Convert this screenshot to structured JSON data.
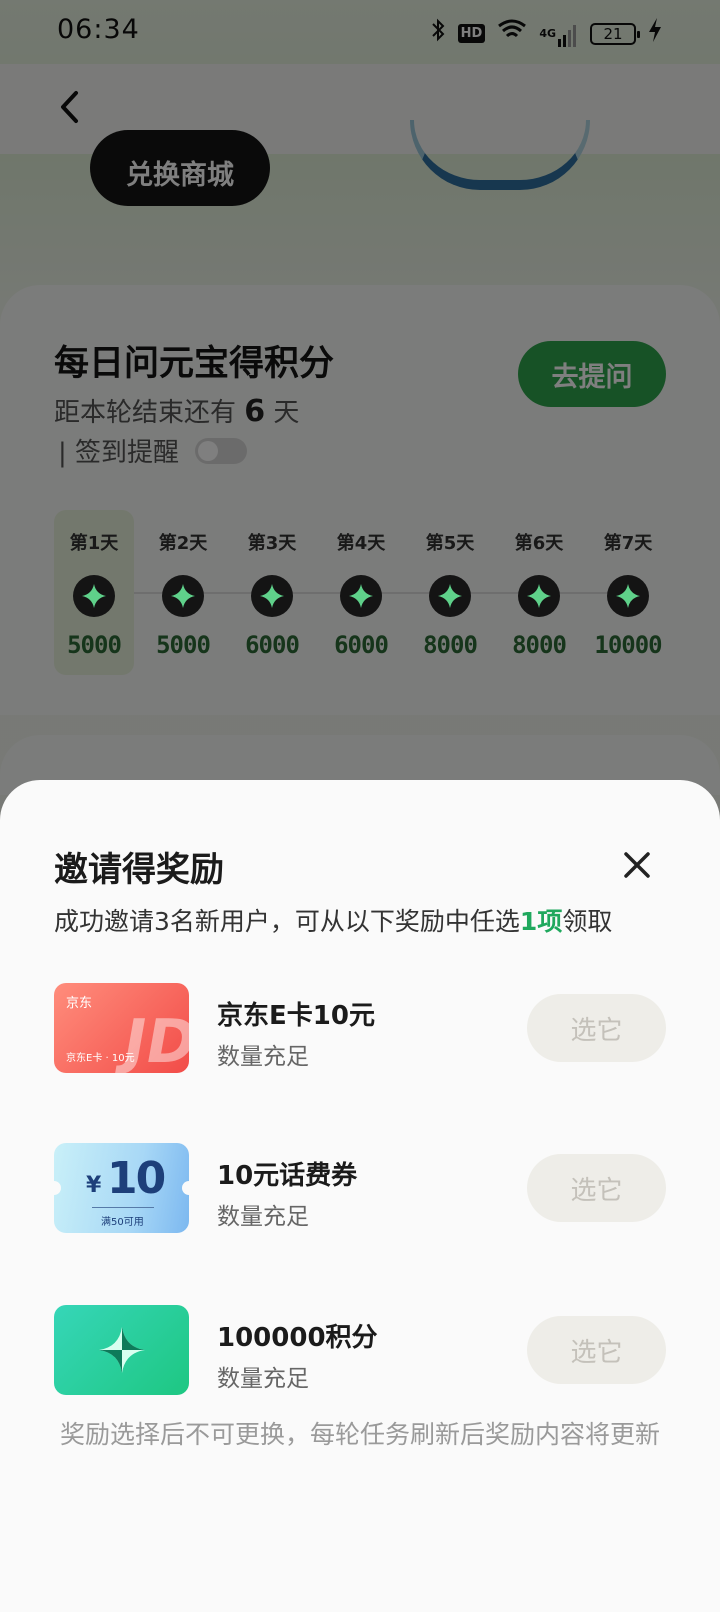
{
  "status_bar": {
    "time": "06:34",
    "hd": "HD",
    "network": "4G",
    "battery": "21"
  },
  "background": {
    "mall_button": "兑换商城",
    "daily": {
      "title": "每日问元宝得积分",
      "countdown_prefix": "距本轮结束还有",
      "countdown_days": "6",
      "countdown_suffix": "天",
      "remind_label": "| 签到提醒",
      "ask_button": "去提问",
      "days": [
        {
          "label": "第1天",
          "points": "5000"
        },
        {
          "label": "第2天",
          "points": "5000"
        },
        {
          "label": "第3天",
          "points": "6000"
        },
        {
          "label": "第4天",
          "points": "6000"
        },
        {
          "label": "第5天",
          "points": "8000"
        },
        {
          "label": "第6天",
          "points": "8000"
        },
        {
          "label": "第7天",
          "points": "10000"
        }
      ]
    }
  },
  "sheet": {
    "title": "邀请得奖励",
    "subtitle_prefix": "成功邀请3名新用户，可从以下奖励中任选",
    "subtitle_highlight": "1项",
    "subtitle_suffix": "领取",
    "rewards": [
      {
        "name": "京东E卡10元",
        "stock": "数量充足",
        "button": "选它",
        "thumb_logo": "京东",
        "thumb_big": "JD",
        "thumb_note": "京东E卡 · 10元"
      },
      {
        "name": "10元话费券",
        "stock": "数量充足",
        "button": "选它",
        "thumb_yen": "¥",
        "thumb_amount": "10",
        "thumb_cond": "满50可用"
      },
      {
        "name": "100000积分",
        "stock": "数量充足",
        "button": "选它"
      }
    ],
    "footer": "奖励选择后不可更换，每轮任务刷新后奖励内容将更新"
  },
  "colors": {
    "accent_green": "#1fa85d",
    "ask_button_green": "#2fa54d",
    "points_green": "#2d6b36"
  },
  "icons": {
    "back": "chevron-left-icon",
    "close": "close-icon",
    "star": "sparkle-star-icon",
    "bluetooth": "bluetooth-icon",
    "wifi": "wifi-icon",
    "signal": "signal-icon",
    "charging": "charging-bolt-icon"
  }
}
